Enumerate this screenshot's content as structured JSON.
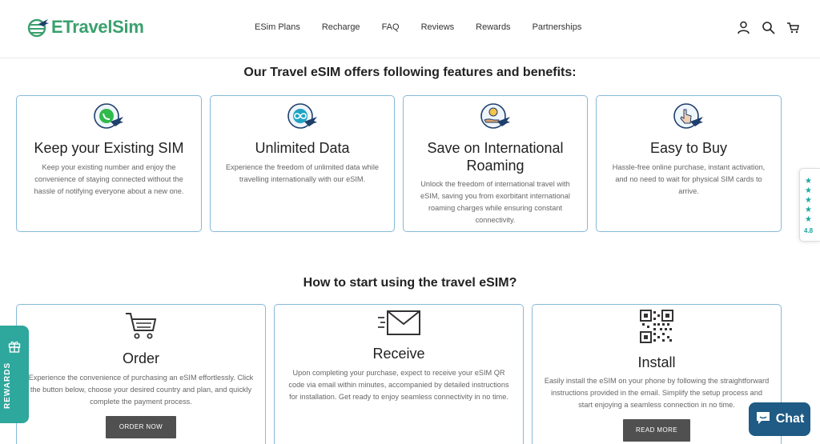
{
  "brand": {
    "name": "ETravelSim",
    "color": "#3aa06e"
  },
  "nav": {
    "items": [
      "ESim Plans",
      "Recharge",
      "FAQ",
      "Reviews",
      "Rewards",
      "Partnerships"
    ]
  },
  "header_icons": [
    "account-icon",
    "search-icon",
    "cart-icon"
  ],
  "features": {
    "title": "Our Travel eSIM offers following features and benefits:",
    "cards": [
      {
        "icon": "whatsapp-plane-icon",
        "title": "Keep your Existing SIM",
        "text": "Keep your existing number and enjoy the convenience of staying connected without the hassle of notifying everyone about a new one."
      },
      {
        "icon": "infinity-plane-icon",
        "title": "Unlimited Data",
        "text": "Experience the freedom of unlimited data while travelling internationally with our eSIM."
      },
      {
        "icon": "money-hand-plane-icon",
        "title": "Save on International Roaming",
        "text": "Unlock the freedom of international travel with eSIM, saving you from exorbitant international roaming charges while ensuring constant connectivity."
      },
      {
        "icon": "click-hand-plane-icon",
        "title": "Easy to Buy",
        "text": "Hassle-free online purchase, instant activation, and no need to wait for physical SIM cards to arrive."
      }
    ]
  },
  "steps": {
    "title": "How to start using the travel eSIM?",
    "cards": [
      {
        "icon": "cart-icon",
        "title": "Order",
        "text": "Experience the convenience of purchasing an eSIM effortlessly. Click the button below, choose your desired country and plan, and quickly complete the payment process.",
        "button": "ORDER NOW"
      },
      {
        "icon": "envelope-icon",
        "title": "Receive",
        "text": "Upon completing your purchase, expect to receive your eSIM QR code via email within minutes, accompanied by detailed instructions for installation. Get ready to enjoy seamless connectivity in no time."
      },
      {
        "icon": "qr-code-icon",
        "title": "Install",
        "text": "Easily install the eSIM on your phone by following the straightforward instructions provided in the email. Simplify the setup process and start enjoying a seamless connection in no time.",
        "button": "READ MORE"
      }
    ]
  },
  "reviews_widget": {
    "stars": "★★★★★",
    "rating": "4.8",
    "color": "#1aa7a1"
  },
  "rewards_tab": {
    "label": "REWARDS",
    "color": "#2ea79d"
  },
  "chat": {
    "label": "Chat",
    "color": "#1f5b84"
  }
}
